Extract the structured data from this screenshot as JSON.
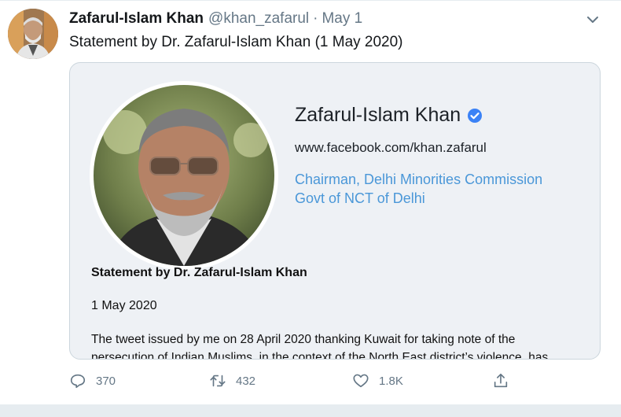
{
  "tweet": {
    "author_name": "Zafarul-Islam Khan",
    "author_handle": "@khan_zafarul",
    "separator": "·",
    "date": "May 1",
    "text": "Statement by Dr. Zafarul-Islam Khan (1 May 2020)",
    "menu_icon": "chevron-down-icon"
  },
  "card": {
    "name": "Zafarul-Islam Khan",
    "link": "www.facebook.com/khan.zafarul",
    "role_line1": "Chairman, Delhi Minorities Commission",
    "role_line2": "Govt of NCT of Delhi",
    "statement_title": "Statement by Dr. Zafarul-Islam Khan",
    "statement_date": "1 May 2020",
    "body_line1": "The tweet issued by me on 28 April 2020 thanking Kuwait for taking note of the",
    "body_line2": "persecution of Indian Muslims, in the context of the North East district’s violence, has"
  },
  "actions": {
    "reply_count": "370",
    "retweet_count": "432",
    "like_count": "1.8K",
    "icons": [
      "reply-icon",
      "retweet-icon",
      "like-icon",
      "share-icon"
    ]
  },
  "colors": {
    "accent": "#1da1f2",
    "role_text": "#4a97d8",
    "muted": "#657786",
    "card_bg": "#eef1f5",
    "border": "#e6ecf0"
  }
}
